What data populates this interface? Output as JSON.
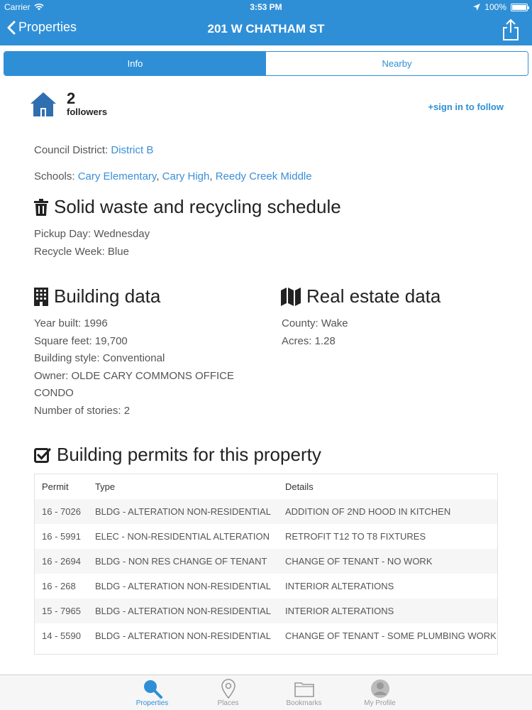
{
  "status": {
    "carrier": "Carrier",
    "time": "3:53 PM",
    "battery": "100%"
  },
  "nav": {
    "back_label": "Properties",
    "title": "201 W CHATHAM ST"
  },
  "tabs": {
    "info": "Info",
    "nearby": "Nearby"
  },
  "followers": {
    "count": "2",
    "label": "followers",
    "sign_in": "+sign in to follow"
  },
  "council": {
    "label": "Council District:",
    "value": "District B"
  },
  "schools": {
    "label": "Schools:",
    "items": [
      "Cary Elementary",
      "Cary High",
      "Reedy Creek Middle"
    ]
  },
  "waste": {
    "title": "Solid waste and recycling schedule",
    "pickup": "Pickup Day: Wednesday",
    "recycle": "Recycle Week: Blue"
  },
  "building": {
    "title": "Building data",
    "year": "Year built: 1996",
    "sqft": "Square feet: 19,700",
    "style": "Building style: Conventional",
    "owner_line1": "Owner: OLDE CARY COMMONS OFFICE",
    "owner_line2": "CONDO",
    "stories": "Number of stories: 2"
  },
  "realestate": {
    "title": "Real estate data",
    "county": "County: Wake",
    "acres": "Acres: 1.28"
  },
  "permits": {
    "title": "Building permits for this property",
    "headers": [
      "Permit",
      "Type",
      "Details"
    ],
    "rows": [
      [
        "16 - 7026",
        "BLDG - ALTERATION NON-RESIDENTIAL",
        "ADDITION OF 2ND HOOD IN KITCHEN"
      ],
      [
        "16 - 5991",
        "ELEC - NON-RESIDENTIAL ALTERATION",
        "RETROFIT T12 TO T8 FIXTURES"
      ],
      [
        "16 - 2694",
        "BLDG - NON RES CHANGE OF TENANT",
        "CHANGE OF TENANT - NO WORK"
      ],
      [
        "16 - 268",
        "BLDG - ALTERATION NON-RESIDENTIAL",
        "INTERIOR ALTERATIONS"
      ],
      [
        "15 - 7965",
        "BLDG - ALTERATION NON-RESIDENTIAL",
        "INTERIOR ALTERATIONS"
      ],
      [
        "14 - 5590",
        "BLDG - ALTERATION NON-RESIDENTIAL",
        "CHANGE OF TENANT - SOME PLUMBING WORK"
      ]
    ]
  },
  "tabbar": {
    "properties": "Properties",
    "places": "Places",
    "bookmarks": "Bookmarks",
    "profile": "My Profile"
  },
  "colors": {
    "accent": "#2f8fd6",
    "link": "#3a8fd6"
  }
}
